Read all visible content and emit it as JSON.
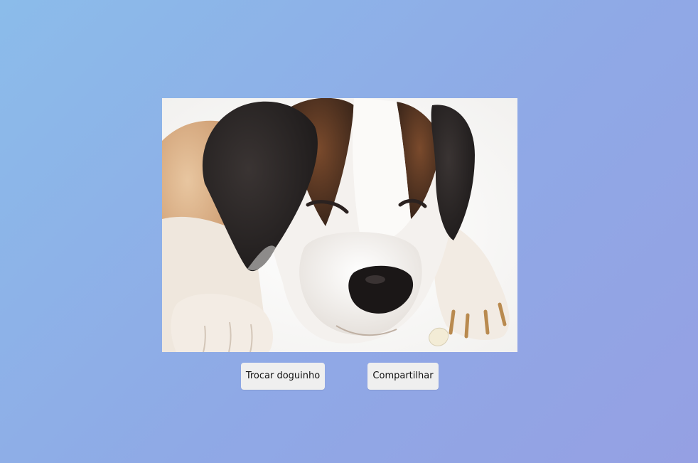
{
  "image": {
    "subject": "sleeping Saint Bernard dog",
    "icon": "dog-photo"
  },
  "buttons": {
    "swap_label": "Trocar doguinho",
    "share_label": "Compartilhar"
  },
  "colors": {
    "background_start": "#8bbcea",
    "background_end": "#95a0e3",
    "button_bg": "#efefef"
  }
}
